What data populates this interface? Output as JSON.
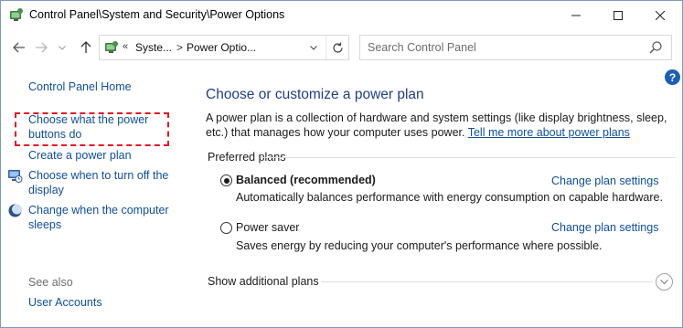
{
  "window": {
    "title": "Control Panel\\System and Security\\Power Options",
    "minimize_glyph": "—",
    "maximize_glyph": "☐",
    "close_glyph": "✕"
  },
  "nav": {
    "back_icon": "arrow-left-icon",
    "forward_icon": "arrow-right-icon",
    "up_icon": "arrow-up-icon"
  },
  "address": {
    "overflow": "«",
    "segment1": "Syste...",
    "separator": ">",
    "segment2": "Power Optio..."
  },
  "search": {
    "placeholder": "Search Control Panel"
  },
  "help": {
    "glyph": "?"
  },
  "left_pane": {
    "home": "Control Panel Home",
    "choose_power_buttons": "Choose what the power buttons do",
    "create_plan": "Create a power plan",
    "turn_off_display": "Choose when to turn off the display",
    "change_sleep": "Change when the computer sleeps",
    "see_also": "See also",
    "user_accounts": "User Accounts"
  },
  "main": {
    "title": "Choose or customize a power plan",
    "description": "A power plan is a collection of hardware and system settings (like display brightness, sleep, etc.) that manages how your computer uses power.",
    "learn_more": "Tell me more about power plans",
    "preferred_plans": "Preferred plans",
    "plans": [
      {
        "name": "Balanced (recommended)",
        "selected": true,
        "description": "Automatically balances performance with energy consumption on capable hardware.",
        "change_link": "Change plan settings"
      },
      {
        "name": "Power saver",
        "selected": false,
        "description": "Saves energy by reducing your computer's performance where possible.",
        "change_link": "Change plan settings"
      }
    ],
    "show_additional": "Show additional plans"
  },
  "colors": {
    "link": "#0e4f9e",
    "title": "#1e3f8a",
    "highlight": "#e81020",
    "help": "#1b5fb4"
  }
}
